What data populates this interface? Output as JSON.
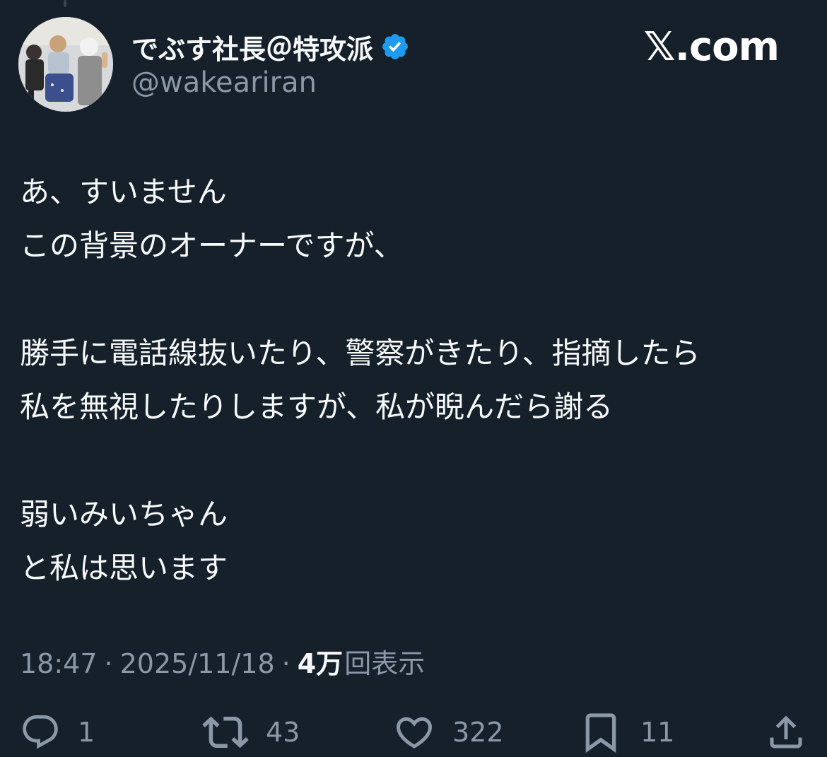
{
  "author": {
    "display_name": "でぶす社長＠特攻派",
    "handle": "@wakeariran",
    "verified": true,
    "verified_color": "#1d9bf0"
  },
  "site_brand": "𝕏.com",
  "tweet": {
    "lines": [
      "あ、すいません",
      "この背景のオーナーですが、",
      "",
      "勝手に電話線抜いたり、警察がきたり、指摘したら",
      "私を無視したりしますが、私が睨んだら謝る",
      "",
      "弱いみいちゃん",
      "と私は思います"
    ]
  },
  "meta": {
    "time": "18:47",
    "separator": "·",
    "date": "2025/11/18",
    "views_count": "4万",
    "views_label": "回表示"
  },
  "actions": {
    "reply": {
      "icon": "reply-icon",
      "count": "1"
    },
    "repost": {
      "icon": "repost-icon",
      "count": "43"
    },
    "like": {
      "icon": "heart-icon",
      "count": "322"
    },
    "bookmark": {
      "icon": "bookmark-icon",
      "count": "11"
    },
    "share": {
      "icon": "share-icon"
    }
  },
  "theme": {
    "background": "#15202b",
    "text": "#f7f9f9",
    "muted": "#8b98a5"
  }
}
